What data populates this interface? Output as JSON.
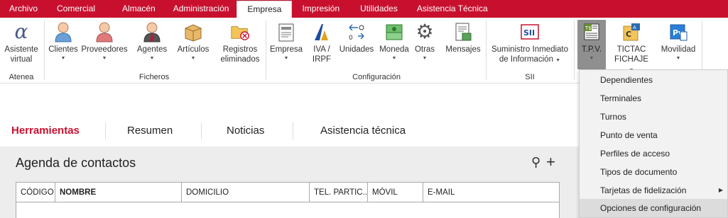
{
  "menu": {
    "tabs": [
      "Archivo",
      "Comercial",
      "Almacén",
      "Administración",
      "Empresa",
      "Impresión",
      "Utilidades",
      "Asistencia Técnica"
    ]
  },
  "ribbon": {
    "buttons": {
      "asistente": [
        "Asistente",
        "virtual"
      ],
      "clientes": "Clientes",
      "proveedores": "Proveedores",
      "agentes": "Agentes",
      "articulos": "Artículos",
      "registros": [
        "Registros",
        "eliminados"
      ],
      "empresa": "Empresa",
      "iva": [
        "IVA /",
        "IRPF"
      ],
      "unidades": "Unidades",
      "moneda": "Moneda",
      "otras": "Otras",
      "mensajes": "Mensajes",
      "sii": [
        "Suministro Inmediato",
        "de Información"
      ],
      "tpv": "T.P.V.",
      "tictac": [
        "TICTAC",
        "FICHAJE"
      ],
      "movilidad": "Movilidad"
    },
    "groups": {
      "atenea": "Atenea",
      "ficheros": "Ficheros",
      "configuracion": "Configuración",
      "sii": "SII"
    },
    "colors": {
      "accent": "#c8102e"
    }
  },
  "tabs": [
    "Herramientas",
    "Resumen",
    "Noticias",
    "Asistencia técnica"
  ],
  "panel": {
    "title": "Agenda de contactos",
    "search_icon": "⚲",
    "add_icon": "+"
  },
  "table": {
    "columns": [
      "CÓDIGO",
      "NOMBRE",
      "DOMICILIO",
      "TEL. PARTIC...",
      "MÓVIL",
      "E-MAIL"
    ]
  },
  "dropdown": {
    "items": [
      "Dependientes",
      "Terminales",
      "Turnos",
      "Punto de venta",
      "Perfiles de acceso",
      "Tipos de documento",
      "Tarjetas de fidelización",
      "Opciones de configuración"
    ]
  }
}
